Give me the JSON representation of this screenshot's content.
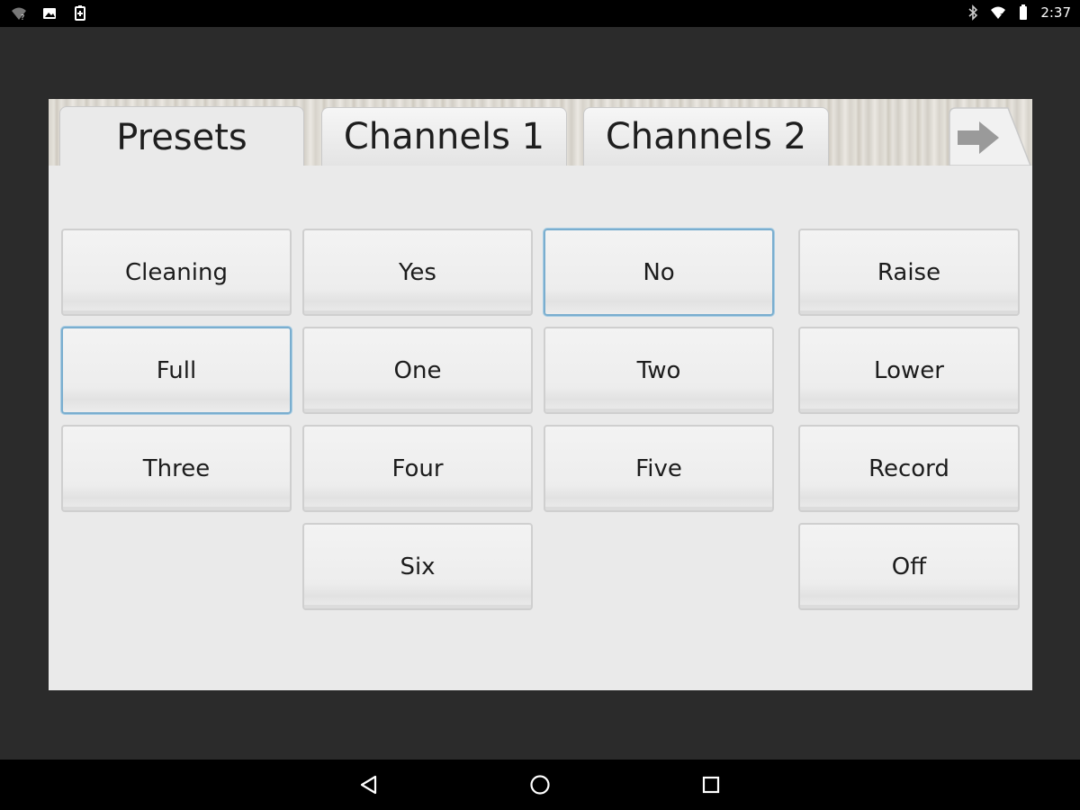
{
  "statusbar": {
    "time": "2:37",
    "left_icons": [
      "wifi-question-icon",
      "image-notification-icon",
      "battery-saver-icon"
    ],
    "right_icons": [
      "bluetooth-icon",
      "wifi-icon",
      "battery-icon"
    ]
  },
  "tabs": [
    {
      "label": "Presets",
      "active": true
    },
    {
      "label": "Channels 1",
      "active": false
    },
    {
      "label": "Channels 2",
      "active": false
    }
  ],
  "next_tab_icon": "right-arrow-icon",
  "buttons": {
    "cleaning": "Cleaning",
    "yes": "Yes",
    "no": "No",
    "raise": "Raise",
    "full": "Full",
    "one": "One",
    "two": "Two",
    "lower": "Lower",
    "three": "Three",
    "four": "Four",
    "five": "Five",
    "record": "Record",
    "six": "Six",
    "off": "Off"
  },
  "selected_buttons": [
    "No",
    "Full"
  ],
  "colors": {
    "selected_border": "#7aaecf",
    "panel_bg": "#eaeaea",
    "frame_bg": "#2b2b2b"
  },
  "navbar": {
    "icons": [
      "back-icon",
      "home-icon",
      "recents-icon"
    ]
  }
}
